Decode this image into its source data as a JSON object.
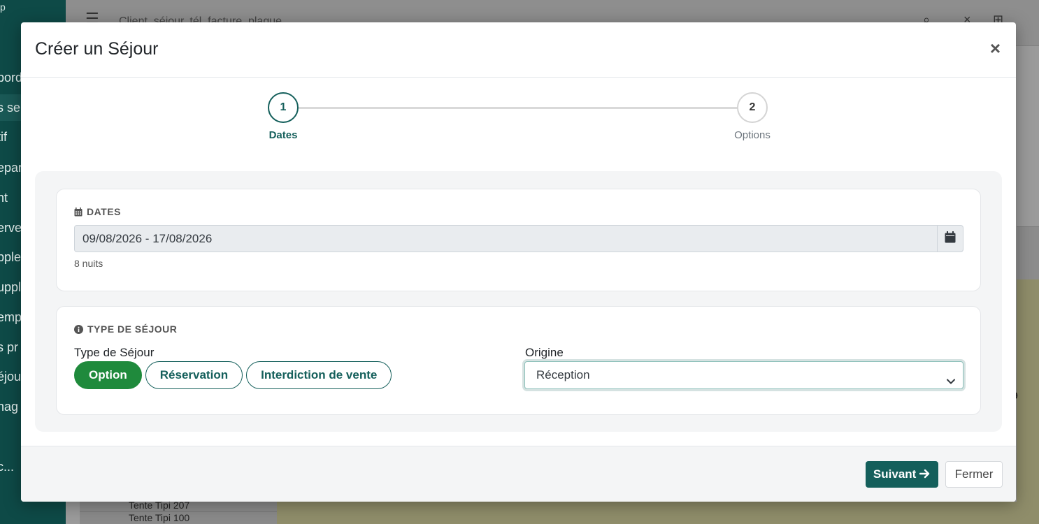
{
  "background": {
    "logo_text": "p",
    "sidebar_items": [
      "bord",
      "s se",
      "tif",
      "epar",
      "nt",
      "erve",
      "pple",
      "uppl",
      "emp",
      "s pr",
      "éjou",
      "nag",
      "c..."
    ],
    "search_placeholder": "Client, séjour, tél, facture, plaque",
    "rows": [
      "Tente Tipi 207",
      "Tente Tipi 100"
    ],
    "right_value": "9"
  },
  "modal": {
    "title": "Créer un Séjour",
    "close_icon": "×",
    "steps": [
      {
        "number": "1",
        "label": "Dates",
        "state": "active"
      },
      {
        "number": "2",
        "label": "Options",
        "state": "inactive"
      }
    ],
    "dates_card": {
      "heading": "DATES",
      "heading_icon": "calendar-icon",
      "range_value": "09/08/2026 - 17/08/2026",
      "nights": "8 nuits"
    },
    "type_card": {
      "heading": "TYPE DE SÉJOUR",
      "heading_icon": "info-circle-icon",
      "type_label": "Type de Séjour",
      "types": [
        "Option",
        "Réservation",
        "Interdiction de vente"
      ],
      "selected_type": "Option",
      "origin_label": "Origine",
      "origin_value": "Réception"
    },
    "footer": {
      "next_label": "Suivant",
      "close_label": "Fermer"
    }
  },
  "colors": {
    "primary": "#145f5b",
    "selected_pill": "#1f8a3c",
    "sidebar": "#0e4a47"
  }
}
